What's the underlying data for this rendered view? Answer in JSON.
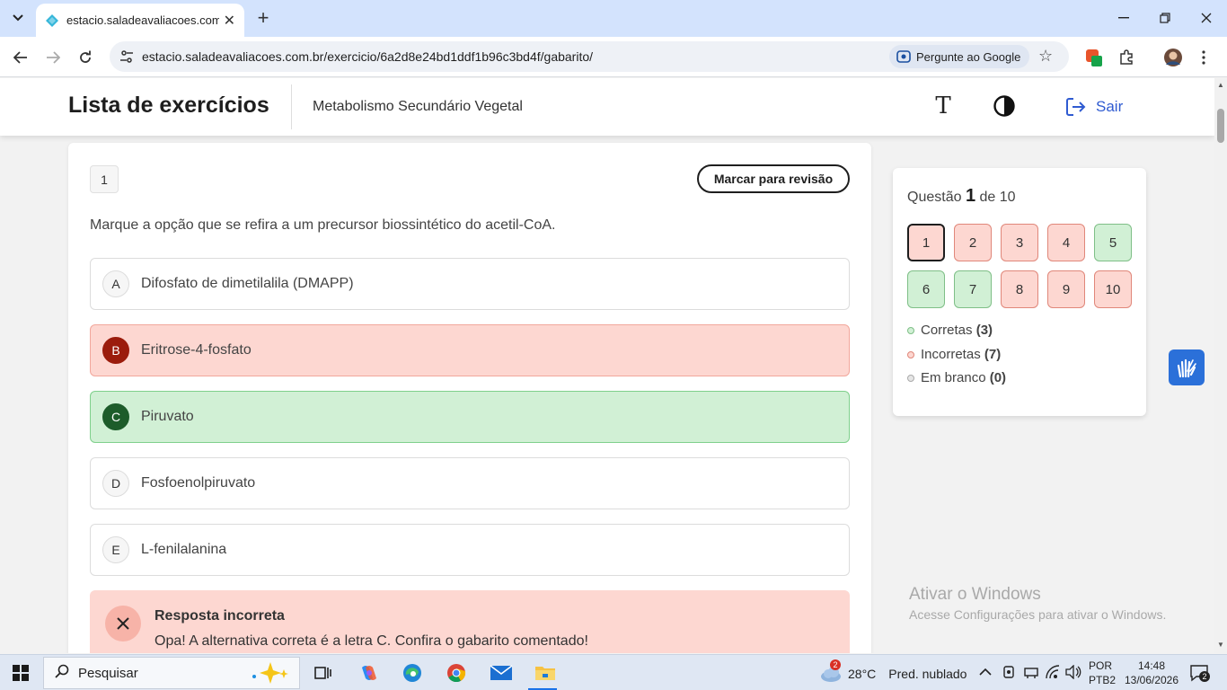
{
  "browser": {
    "tab_title": "estacio.saladeavaliacoes.com.br",
    "url": "estacio.saladeavaliacoes.com.br/exercicio/6a2d8e24bd1ddf1b96c3bd4f/gabarito/",
    "ask_google_label": "Pergunte ao Google"
  },
  "header": {
    "title": "Lista de exercícios",
    "subject": "Metabolismo Secundário Vegetal",
    "font_button": "T",
    "logout_label": "Sair"
  },
  "question": {
    "number": "1",
    "review_label": "Marcar para revisão",
    "text": "Marque a opção que se refira a um precursor biossintético do acetil-CoA.",
    "options": [
      {
        "letter": "A",
        "text": "Difosfato de dimetilalila (DMAPP)",
        "state": "neutral"
      },
      {
        "letter": "B",
        "text": "Eritrose-4-fosfato",
        "state": "wrong"
      },
      {
        "letter": "C",
        "text": "Piruvato",
        "state": "right"
      },
      {
        "letter": "D",
        "text": "Fosfoenolpiruvato",
        "state": "neutral"
      },
      {
        "letter": "E",
        "text": "L-fenilalanina",
        "state": "neutral"
      }
    ],
    "feedback": {
      "title": "Resposta incorreta",
      "message": "Opa! A alternativa correta é a letra C. Confira o gabarito comentado!"
    }
  },
  "navigator": {
    "label_prefix": "Questão",
    "current": "1",
    "label_suffix": "de 10",
    "questions": [
      {
        "n": "1",
        "status": "incorrect",
        "current": true
      },
      {
        "n": "2",
        "status": "incorrect"
      },
      {
        "n": "3",
        "status": "incorrect"
      },
      {
        "n": "4",
        "status": "incorrect"
      },
      {
        "n": "5",
        "status": "correct"
      },
      {
        "n": "6",
        "status": "correct"
      },
      {
        "n": "7",
        "status": "correct"
      },
      {
        "n": "8",
        "status": "incorrect"
      },
      {
        "n": "9",
        "status": "incorrect"
      },
      {
        "n": "10",
        "status": "incorrect"
      }
    ],
    "legend": {
      "correct_label": "Corretas",
      "correct_count": "(3)",
      "incorrect_label": "Incorretas",
      "incorrect_count": "(7)",
      "blank_label": "Em branco",
      "blank_count": "(0)"
    }
  },
  "watermark": {
    "line1": "Ativar o Windows",
    "line2": "Acesse Configurações para ativar o Windows."
  },
  "taskbar": {
    "search_placeholder": "Pesquisar",
    "weather_badge": "2",
    "temperature": "28°C",
    "weather_text": "Pred. nublado",
    "lang_line1": "POR",
    "lang_line2": "PTB2",
    "time": "14:48",
    "date": "13/06/2026",
    "notification_count": "2"
  },
  "colors": {
    "accent_blue": "#2f5bd1",
    "incorrect_bg": "#fdd7d1",
    "correct_bg": "#d1f0d5",
    "wrong_letter": "#9b1c0c",
    "right_letter": "#1d5c2a"
  }
}
